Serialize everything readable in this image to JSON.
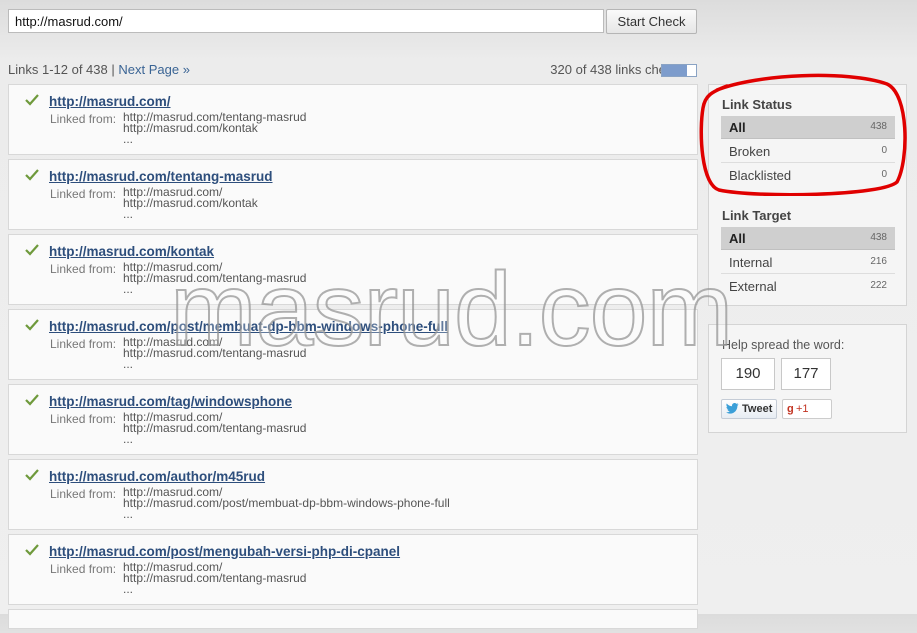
{
  "search": {
    "value": "http://masrud.com/",
    "button_label": "Start Check"
  },
  "paging": {
    "summary": "Links 1-12 of 438",
    "separator": "|",
    "next_label": "Next Page »"
  },
  "progress": {
    "text": "320 of 438 links checked.",
    "checked": 320,
    "total": 438
  },
  "links": [
    {
      "url": "http://masrud.com/",
      "linked_label": "Linked from:",
      "sources": [
        "http://masrud.com/tentang-masrud",
        "http://masrud.com/kontak",
        "..."
      ]
    },
    {
      "url": "http://masrud.com/tentang-masrud",
      "linked_label": "Linked from:",
      "sources": [
        "http://masrud.com/",
        "http://masrud.com/kontak",
        "..."
      ]
    },
    {
      "url": "http://masrud.com/kontak",
      "linked_label": "Linked from:",
      "sources": [
        "http://masrud.com/",
        "http://masrud.com/tentang-masrud",
        "..."
      ]
    },
    {
      "url": "http://masrud.com/post/membuat-dp-bbm-windows-phone-full",
      "linked_label": "Linked from:",
      "sources": [
        "http://masrud.com/",
        "http://masrud.com/tentang-masrud",
        "..."
      ]
    },
    {
      "url": "http://masrud.com/tag/windowsphone",
      "linked_label": "Linked from:",
      "sources": [
        "http://masrud.com/",
        "http://masrud.com/tentang-masrud",
        "..."
      ]
    },
    {
      "url": "http://masrud.com/author/m45rud",
      "linked_label": "Linked from:",
      "sources": [
        "http://masrud.com/",
        "http://masrud.com/post/membuat-dp-bbm-windows-phone-full",
        "..."
      ]
    },
    {
      "url": "http://masrud.com/post/mengubah-versi-php-di-cpanel",
      "linked_label": "Linked from:",
      "sources": [
        "http://masrud.com/",
        "http://masrud.com/tentang-masrud",
        "..."
      ]
    }
  ],
  "link_status": {
    "title": "Link Status",
    "items": [
      {
        "label": "All",
        "count": "438",
        "active": true
      },
      {
        "label": "Broken",
        "count": "0"
      },
      {
        "label": "Blacklisted",
        "count": "0"
      }
    ]
  },
  "link_target": {
    "title": "Link Target",
    "items": [
      {
        "label": "All",
        "count": "438",
        "active": true
      },
      {
        "label": "Internal",
        "count": "216"
      },
      {
        "label": "External",
        "count": "222"
      }
    ]
  },
  "share": {
    "title": "Help spread the word:",
    "tweet_count": "190",
    "gplus_count": "177",
    "tweet_label": "Tweet",
    "gplus_label": "+1"
  },
  "watermark": "masrud.com",
  "colors": {
    "link": "#2d4e7c",
    "check": "#6f9a3c",
    "annotation": "#e00000",
    "progress": "#7d9ccc"
  }
}
